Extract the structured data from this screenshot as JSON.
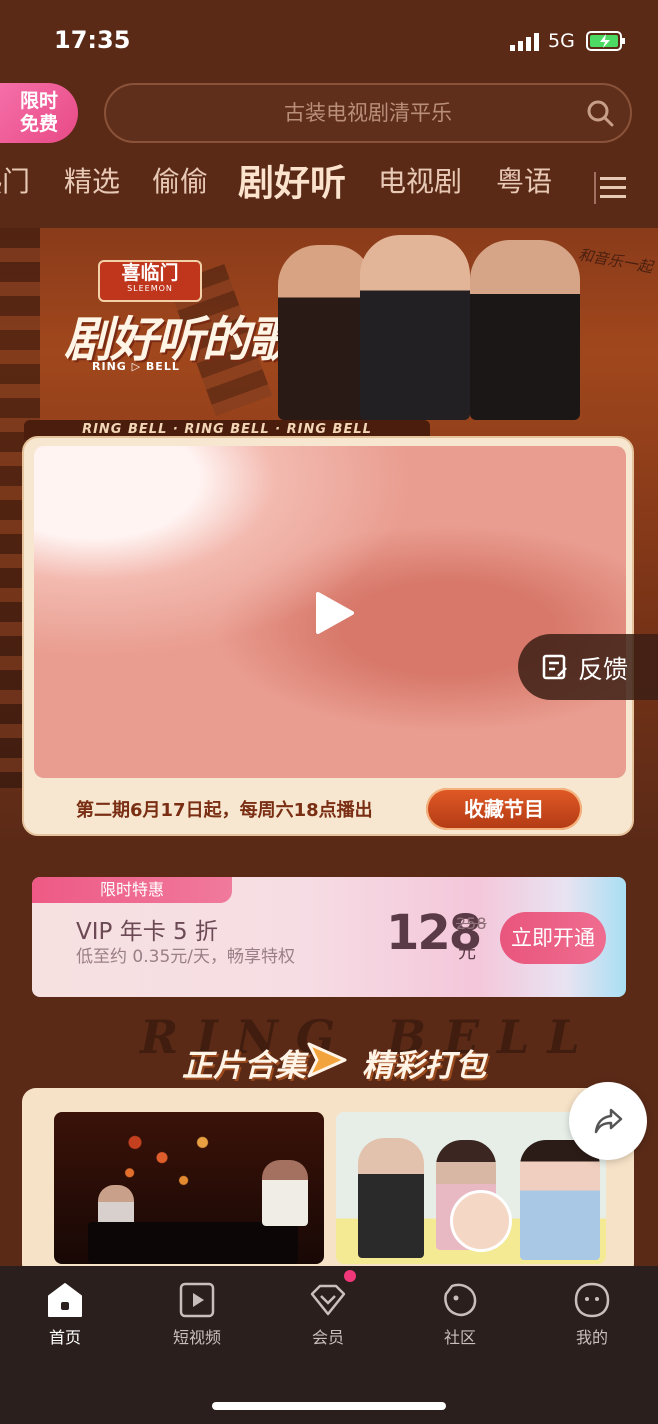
{
  "status": {
    "time": "17:35",
    "network": "5G"
  },
  "header": {
    "promo_badge": "限时\n免费",
    "search_placeholder": "古装电视剧清平乐"
  },
  "tabs": [
    "热门",
    "精选",
    "偷偷",
    "剧好听",
    "电视剧",
    "粤语"
  ],
  "active_tab": "剧好听",
  "banner": {
    "brand_cn": "喜临门",
    "brand_en": "SLEEMON",
    "show_title": "剧好听的歌",
    "show_sub": "RING ▷ BELL",
    "signature": "和音乐一起",
    "ring_strip": "RING BELL · RING BELL · RING BELL",
    "schedule": "第二期6月17日起，每周六18点播出",
    "favorite_button": "收藏节目"
  },
  "feedback": {
    "label": "反馈"
  },
  "vip_offer": {
    "tag": "限时特惠",
    "title": "VIP 年卡 5 折",
    "subtitle": "低至约 0.35元/天，畅享特权",
    "price": "128",
    "original_price": "258",
    "unit": "元",
    "button": "立即开通"
  },
  "section": {
    "bg_word": "RING BELL",
    "title_left": "正片合集",
    "title_right": "精彩打包"
  },
  "bottom_nav": [
    {
      "label": "首页",
      "icon": "home-icon",
      "active": true
    },
    {
      "label": "短视频",
      "icon": "short-video-icon",
      "active": false
    },
    {
      "label": "会员",
      "icon": "vip-diamond-icon",
      "active": false
    },
    {
      "label": "社区",
      "icon": "community-icon",
      "active": false
    },
    {
      "label": "我的",
      "icon": "profile-icon",
      "active": false
    }
  ],
  "colors": {
    "background": "#5a2a17",
    "accent": "#e84a86",
    "button_orange": "#d24a1e",
    "tabbar": "#2a1f1c"
  }
}
